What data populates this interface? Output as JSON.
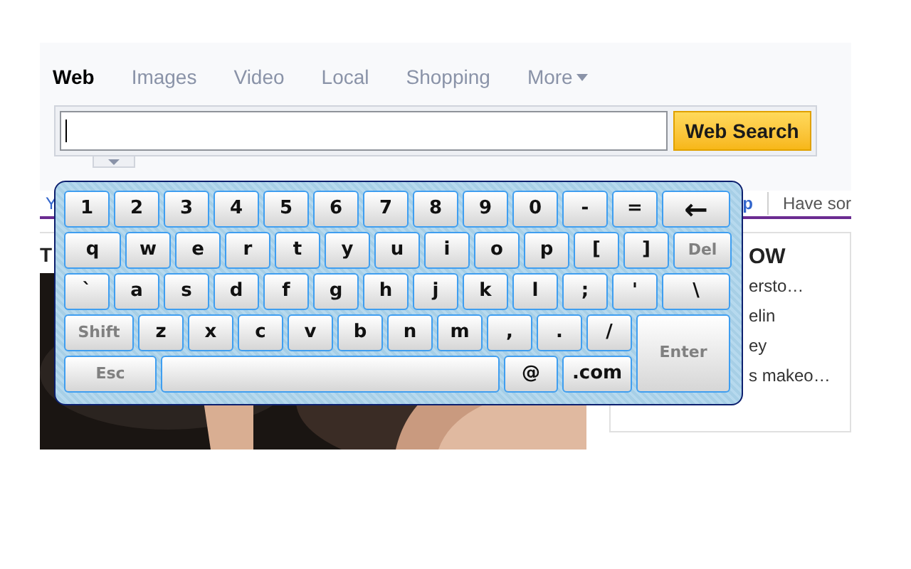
{
  "tabs": [
    {
      "label": "Web",
      "selected": true
    },
    {
      "label": "Images",
      "selected": false
    },
    {
      "label": "Video",
      "selected": false
    },
    {
      "label": "Local",
      "selected": false
    },
    {
      "label": "Shopping",
      "selected": false
    },
    {
      "label": "More",
      "selected": false,
      "dropdown": true
    }
  ],
  "search": {
    "button": "Web Search"
  },
  "subnav": {
    "left": "Y",
    "right_partial": "p",
    "right": "Have sor"
  },
  "heading": "T",
  "right_panel": {
    "heading": "OW",
    "items": [
      "ersto…",
      "elin",
      "ey",
      "s makeo…"
    ]
  },
  "keyboard": {
    "rows": [
      [
        {
          "label": "1",
          "kind": "key"
        },
        {
          "label": "2",
          "kind": "key"
        },
        {
          "label": "3",
          "kind": "key"
        },
        {
          "label": "4",
          "kind": "key"
        },
        {
          "label": "5",
          "kind": "key"
        },
        {
          "label": "6",
          "kind": "key"
        },
        {
          "label": "7",
          "kind": "key"
        },
        {
          "label": "8",
          "kind": "key"
        },
        {
          "label": "9",
          "kind": "key"
        },
        {
          "label": "0",
          "kind": "key"
        },
        {
          "label": "-",
          "kind": "key"
        },
        {
          "label": "=",
          "kind": "key"
        },
        {
          "label": "←",
          "kind": "backspace"
        }
      ],
      [
        {
          "label": "q",
          "kind": "wide"
        },
        {
          "label": "w",
          "kind": "key"
        },
        {
          "label": "e",
          "kind": "key"
        },
        {
          "label": "r",
          "kind": "key"
        },
        {
          "label": "t",
          "kind": "key"
        },
        {
          "label": "y",
          "kind": "key"
        },
        {
          "label": "u",
          "kind": "key"
        },
        {
          "label": "i",
          "kind": "key"
        },
        {
          "label": "o",
          "kind": "key"
        },
        {
          "label": "p",
          "kind": "key"
        },
        {
          "label": "[",
          "kind": "key"
        },
        {
          "label": "]",
          "kind": "key"
        },
        {
          "label": "Del",
          "kind": "del"
        }
      ],
      [
        {
          "label": "`",
          "kind": "key"
        },
        {
          "label": "a",
          "kind": "key"
        },
        {
          "label": "s",
          "kind": "key"
        },
        {
          "label": "d",
          "kind": "key"
        },
        {
          "label": "f",
          "kind": "key"
        },
        {
          "label": "g",
          "kind": "key"
        },
        {
          "label": "h",
          "kind": "key"
        },
        {
          "label": "j",
          "kind": "key"
        },
        {
          "label": "k",
          "kind": "key"
        },
        {
          "label": "l",
          "kind": "key"
        },
        {
          "label": ";",
          "kind": "key"
        },
        {
          "label": "'",
          "kind": "key"
        },
        {
          "label": "\\",
          "kind": "backspace"
        }
      ],
      [
        {
          "label": "Shift",
          "kind": "shift"
        },
        {
          "label": "z",
          "kind": "key"
        },
        {
          "label": "x",
          "kind": "key"
        },
        {
          "label": "c",
          "kind": "key"
        },
        {
          "label": "v",
          "kind": "key"
        },
        {
          "label": "b",
          "kind": "key"
        },
        {
          "label": "n",
          "kind": "key"
        },
        {
          "label": "m",
          "kind": "key"
        },
        {
          "label": ",",
          "kind": "key"
        },
        {
          "label": ".",
          "kind": "key"
        },
        {
          "label": "/",
          "kind": "key"
        }
      ]
    ],
    "bottom_row": [
      {
        "label": "Esc",
        "kind": "esc"
      },
      {
        "kind": "space"
      },
      {
        "label": "@",
        "kind": "at"
      },
      {
        "label": ".com",
        "kind": "dotcom"
      }
    ],
    "enter_key": {
      "label": "Enter",
      "kind": "enter"
    }
  }
}
